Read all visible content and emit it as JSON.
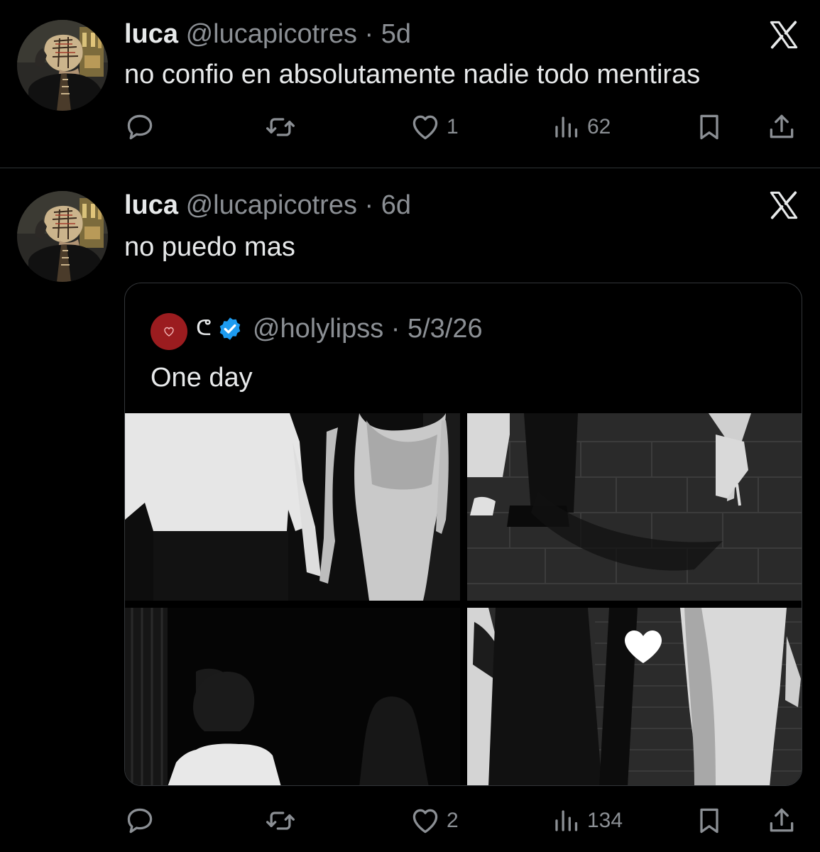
{
  "tweets": [
    {
      "name": "luca",
      "handle": "@lucapicotres · 5d",
      "text": "no confio en absolutamente nadie todo mentiras",
      "likes": "1",
      "views": "62"
    },
    {
      "name": "luca",
      "handle": "@lucapicotres · 6d",
      "text": "no puedo mas",
      "likes": "2",
      "views": "134",
      "quote": {
        "name": "ᕦ",
        "handle": "@holylipss · 5/3/26",
        "text": "One day"
      }
    }
  ],
  "icons": {
    "reply": "reply-icon",
    "retweet": "retweet-icon",
    "like": "heart-icon",
    "views": "views-icon",
    "bookmark": "bookmark-icon",
    "share": "share-icon",
    "brand": "x-logo-icon",
    "verified": "verified-badge-icon"
  },
  "colors": {
    "background": "#000000",
    "text": "#e7e9ea",
    "secondary": "#8b8f94",
    "divider": "#2f3336",
    "verified": "#1d9bf0",
    "quote_avatar": "#9b1c1f"
  }
}
